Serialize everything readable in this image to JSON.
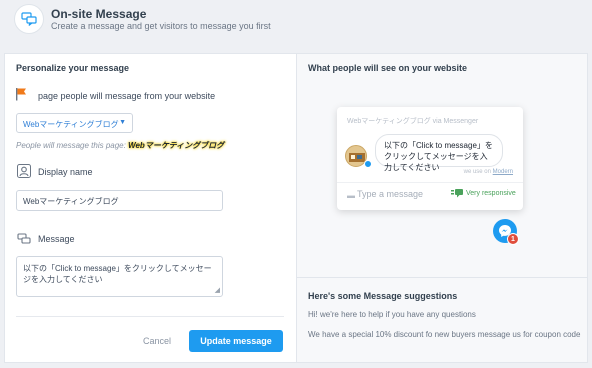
{
  "header": {
    "title": "On-site Message",
    "subtitle": "Create a message and get visitors to message you first",
    "icon": "chat-bubbles-icon"
  },
  "personalize": {
    "title": "Personalize your message",
    "page_label": "page people will message from your website",
    "page_select_value": "Webマーケティングブログ",
    "helper_prefix": "People will message this page:",
    "helper_page": "Webマーケティングブログ",
    "display_name_label": "Display name",
    "display_name_value": "Webマーケティングブログ",
    "message_label": "Message",
    "message_value": "以下の「Click to message」をクリックしてメッセージを入力してください",
    "cancel_label": "Cancel",
    "update_label": "Update message"
  },
  "preview": {
    "title": "What people will see on your website",
    "widget_title": "Webマーケティングブログ via Messenger",
    "bubble_text": "以下の「Click to message」をクリックしてメッセージを入力してください",
    "we_use_prefix": "we use on",
    "we_use_link": "Modern",
    "type_placeholder": "Type a message",
    "responsive_label": "Very responsive",
    "badge_count": "1"
  },
  "suggestions": {
    "title": "Here's some Message suggestions",
    "items": [
      "Hi! we're here to help if you have any questions",
      "We have a special 10% discount fo new buyers message us for coupon code"
    ]
  },
  "colors": {
    "accent": "#1e9bf0",
    "responsive": "#4aa25b",
    "badge": "#e04e3c",
    "flag": "#f07a1a"
  }
}
